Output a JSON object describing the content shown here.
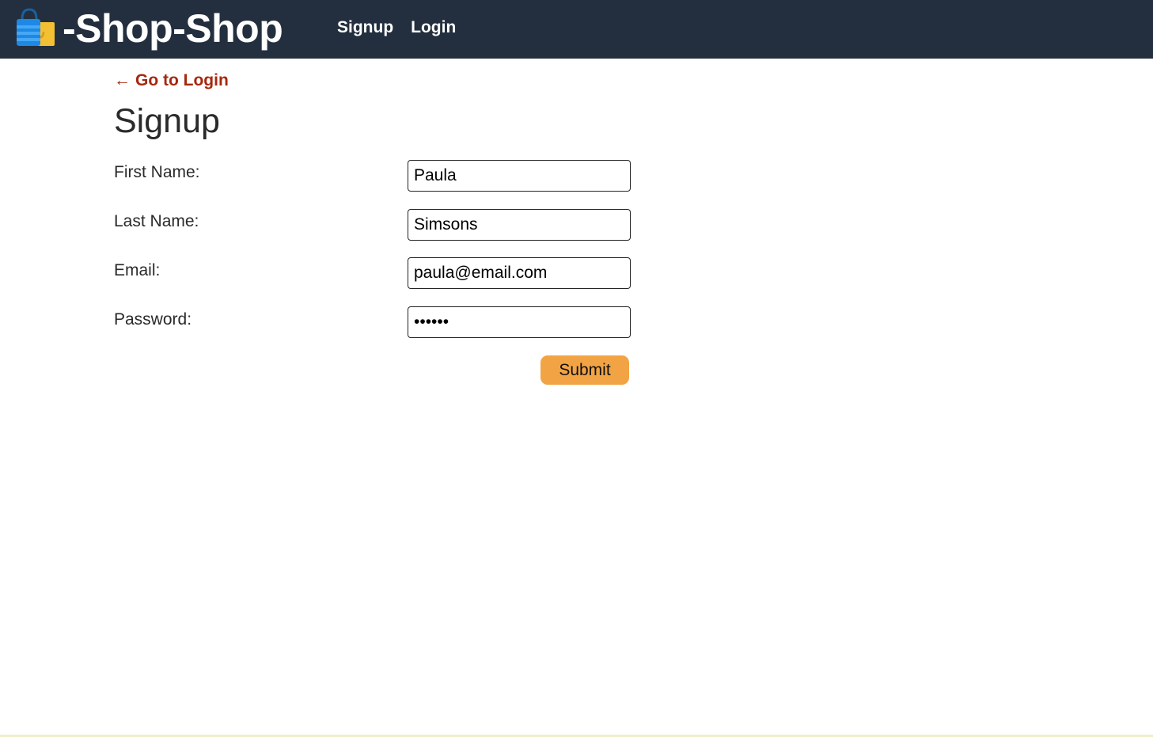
{
  "navbar": {
    "brand_name": "-Shop-Shop",
    "brand_icon": "shopping-bag-icon",
    "links": [
      {
        "label": "Signup"
      },
      {
        "label": "Login"
      }
    ],
    "background": "#232f3e"
  },
  "back_link": {
    "arrow": "←",
    "label": "Go to Login",
    "color": "#a5280f"
  },
  "page_title": "Signup",
  "form": {
    "first_name": {
      "label": "First Name:",
      "value": "Paula"
    },
    "last_name": {
      "label": "Last Name:",
      "value": "Simsons"
    },
    "email": {
      "label": "Email:",
      "value": "paula@email.com"
    },
    "password": {
      "label": "Password:",
      "value": "******"
    },
    "submit_label": "Submit",
    "submit_color": "#f2a444"
  }
}
